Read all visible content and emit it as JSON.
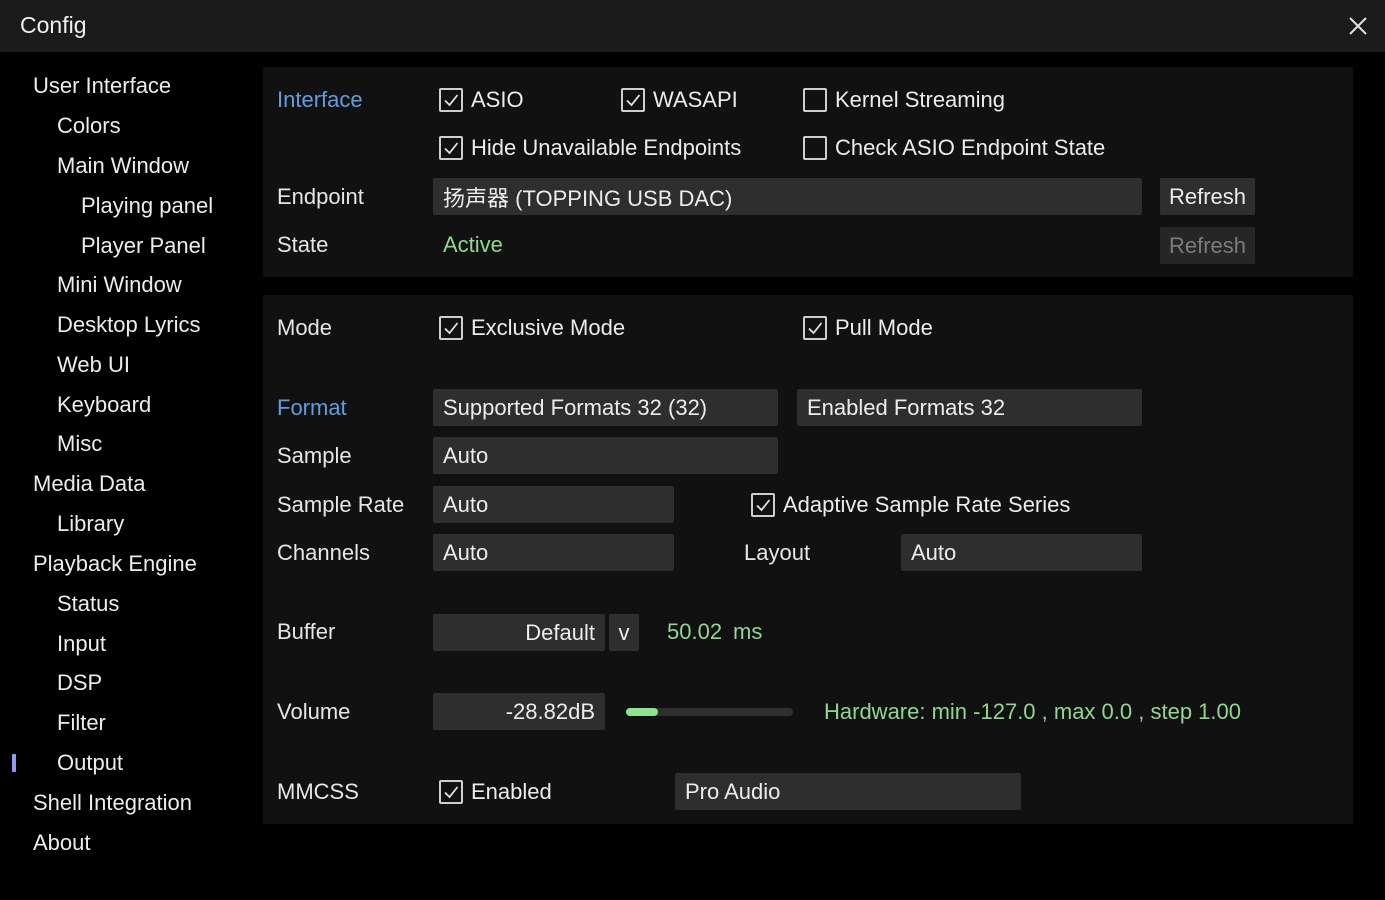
{
  "window": {
    "title": "Config"
  },
  "sidebar": {
    "items": [
      {
        "label": "User Interface",
        "level": 0
      },
      {
        "label": "Colors",
        "level": 1
      },
      {
        "label": "Main Window",
        "level": 1
      },
      {
        "label": "Playing panel",
        "level": 2
      },
      {
        "label": "Player Panel",
        "level": 2
      },
      {
        "label": "Mini Window",
        "level": 1
      },
      {
        "label": "Desktop Lyrics",
        "level": 1
      },
      {
        "label": "Web UI",
        "level": 1
      },
      {
        "label": "Keyboard",
        "level": 1
      },
      {
        "label": "Misc",
        "level": 1
      },
      {
        "label": "Media Data",
        "level": 0
      },
      {
        "label": "Library",
        "level": 1
      },
      {
        "label": "Playback Engine",
        "level": 0
      },
      {
        "label": "Status",
        "level": 1
      },
      {
        "label": "Input",
        "level": 1
      },
      {
        "label": "DSP",
        "level": 1
      },
      {
        "label": "Filter",
        "level": 1
      },
      {
        "label": "Output",
        "level": 1,
        "selected": true
      },
      {
        "label": "Shell Integration",
        "level": 0
      },
      {
        "label": "About",
        "level": 0
      }
    ]
  },
  "interface": {
    "section_label": "Interface",
    "asio": {
      "label": "ASIO",
      "checked": true
    },
    "wasapi": {
      "label": "WASAPI",
      "checked": true
    },
    "kernel_streaming": {
      "label": "Kernel Streaming",
      "checked": false
    },
    "hide_unavailable": {
      "label": "Hide Unavailable Endpoints",
      "checked": true
    },
    "check_asio": {
      "label": "Check ASIO Endpoint State",
      "checked": false
    },
    "endpoint_label": "Endpoint",
    "endpoint_value": "扬声器 (TOPPING USB DAC)",
    "refresh_label": "Refresh",
    "state_label": "State",
    "state_value": "Active",
    "state_refresh_label": "Refresh"
  },
  "output": {
    "mode_label": "Mode",
    "exclusive_mode": {
      "label": "Exclusive Mode",
      "checked": true
    },
    "pull_mode": {
      "label": "Pull Mode",
      "checked": true
    },
    "format_label": "Format",
    "supported_formats": "Supported Formats 32 (32)",
    "enabled_formats": "Enabled Formats 32",
    "sample_label": "Sample",
    "sample_value": "Auto",
    "sample_rate_label": "Sample Rate",
    "sample_rate_value": "Auto",
    "adaptive_rate": {
      "label": "Adaptive Sample Rate Series",
      "checked": true
    },
    "channels_label": "Channels",
    "channels_value": "Auto",
    "layout_label": "Layout",
    "layout_value": "Auto",
    "buffer_label": "Buffer",
    "buffer_value": "Default",
    "buffer_dropdown": "v",
    "buffer_ms": "50.02",
    "buffer_unit": "ms",
    "volume_label": "Volume",
    "volume_value": "-28.82dB",
    "volume_level": 0.19,
    "hardware_info": "Hardware: min -127.0 , max  0.0 , step  1.00",
    "mmcss_label": "MMCSS",
    "mmcss_enabled": {
      "label": "Enabled",
      "checked": true
    },
    "mmcss_value": "Pro Audio"
  },
  "colors": {
    "accent": "#5f9fe0",
    "status_green": "#8fd88f",
    "slider_fill": "#8ee48e",
    "selection_marker": "#8f9cf3"
  }
}
